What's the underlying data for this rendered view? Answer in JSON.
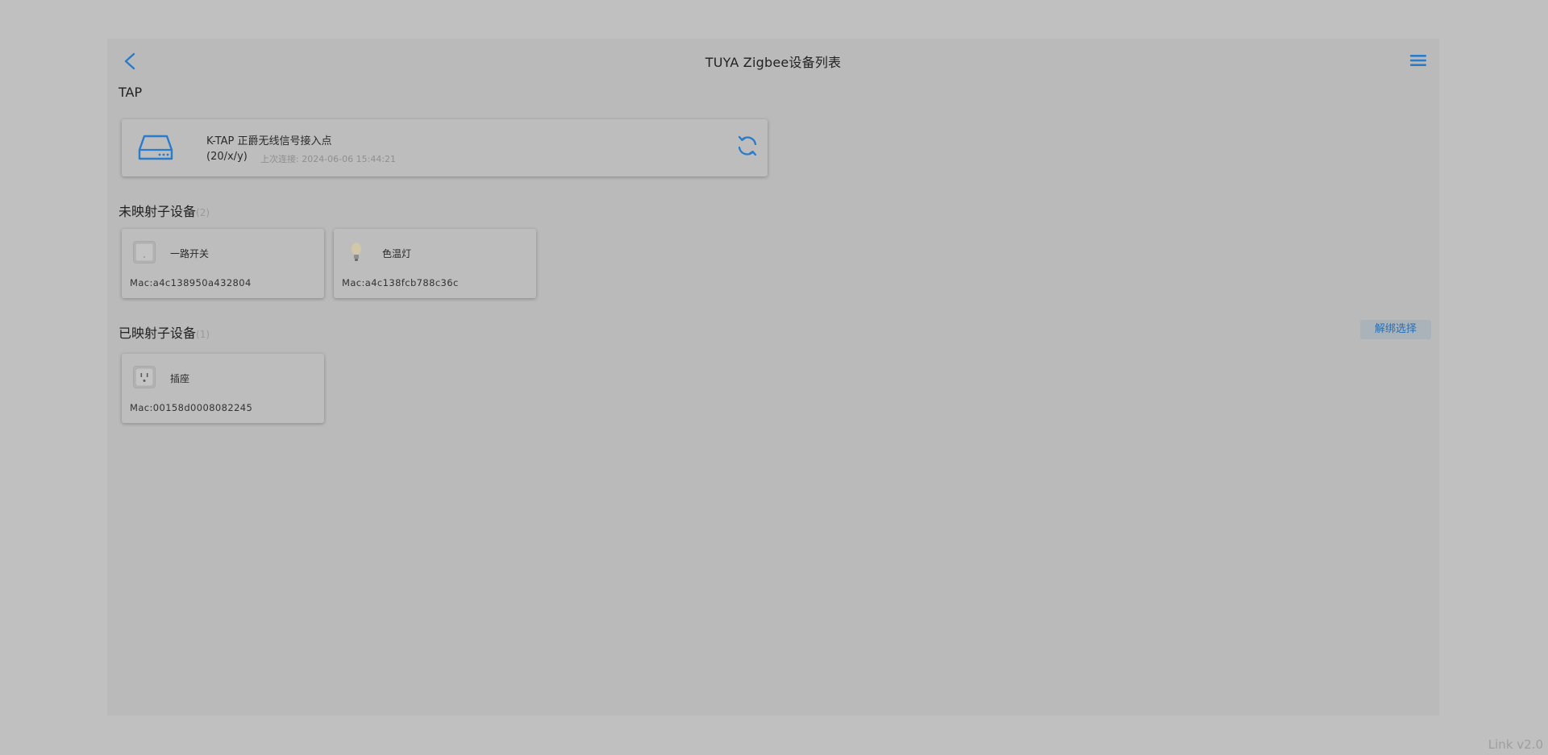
{
  "header": {
    "title": "TUYA Zigbee设备列表",
    "back_icon": "chevron-left-icon",
    "menu_icon": "hamburger-menu-icon"
  },
  "tap_section": {
    "label": "TAP",
    "card": {
      "name": "K-TAP 正爵无线信号接入点",
      "id": "(20/x/y)",
      "last_connect": "上次连接: 2024-06-06 15:44:21",
      "icon": "router-icon",
      "refresh_icon": "refresh-icon"
    }
  },
  "unmapped": {
    "label": "未映射子设备",
    "count": "(2)",
    "devices": [
      {
        "name": "一路开关",
        "mac": "Mac:a4c138950a432804",
        "icon": "switch-icon"
      },
      {
        "name": "色温灯",
        "mac": "Mac:a4c138fcb788c36c",
        "icon": "bulb-icon"
      }
    ]
  },
  "mapped": {
    "label": "已映射子设备",
    "count": "(1)",
    "unbind_label": "解绑选择",
    "devices": [
      {
        "name": "插座",
        "mac": "Mac:00158d0008082245",
        "icon": "socket-icon"
      }
    ]
  },
  "footer": {
    "version": "Link v2.0"
  },
  "colors": {
    "accent": "#2a7bc8",
    "background": "#c0c0c0",
    "panel": "#bababa"
  }
}
